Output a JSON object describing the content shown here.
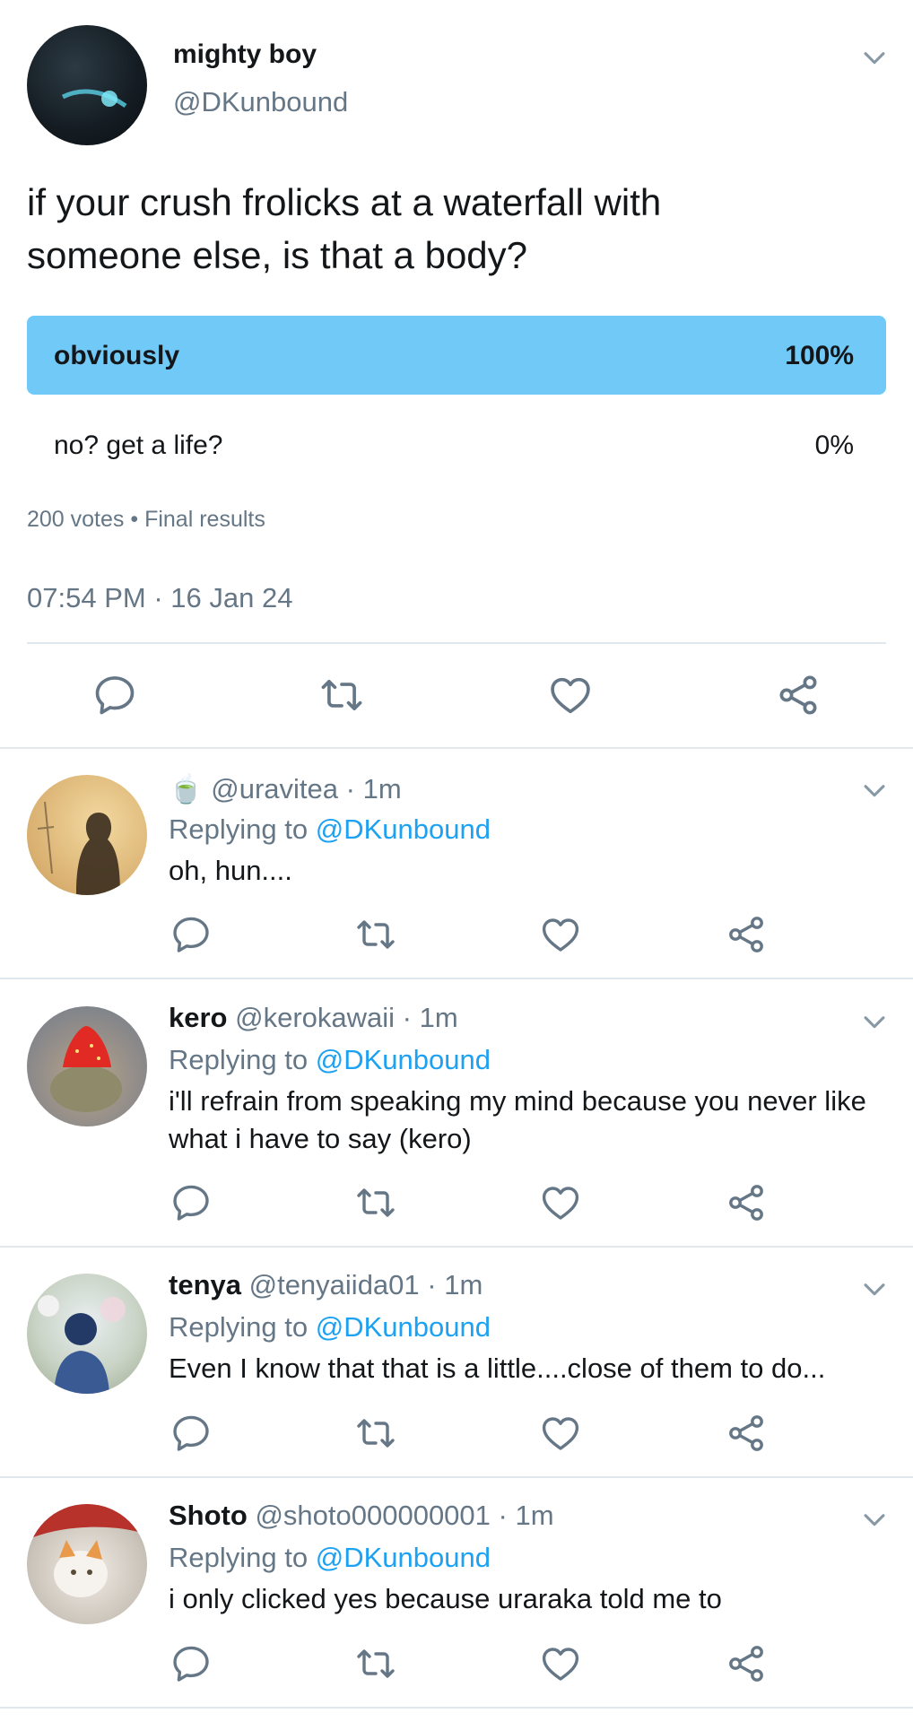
{
  "tweet": {
    "display_name": "mighty boy",
    "handle": "@DKunbound",
    "text": "if your crush frolicks at a waterfall with someone else, is that a body?",
    "poll": {
      "options": [
        {
          "label": "obviously",
          "percent": "100%",
          "value": 1.0
        },
        {
          "label": "no? get a life?",
          "percent": "0%",
          "value": 0.0
        }
      ],
      "votes": "200 votes",
      "status": "Final results"
    },
    "time": "07:54 PM",
    "date": "16 Jan 24"
  },
  "colors": {
    "poll_winner": "#71c9f8",
    "accent": "#1da1f2",
    "secondary_text": "#657786",
    "divider": "#e1e8ed"
  },
  "icons": [
    "chevron-down-icon",
    "reply-icon",
    "retweet-icon",
    "like-icon",
    "share-icon"
  ],
  "replies": [
    {
      "emoji": "🍵",
      "name": "",
      "handle": "@uravitea",
      "time": "1m",
      "replying_prefix": "Replying to",
      "replying_to": "@DKunbound",
      "text": "oh, hun...."
    },
    {
      "name": "kero",
      "handle": "@kerokawaii",
      "time": "1m",
      "replying_prefix": "Replying to",
      "replying_to": "@DKunbound",
      "text": "i'll refrain from speaking my mind because you never like what i have to say (kero)"
    },
    {
      "name": "tenya",
      "handle": "@tenyaiida01",
      "time": "1m",
      "replying_prefix": "Replying to",
      "replying_to": "@DKunbound",
      "text": "Even I know that that is a little....close of them to do..."
    },
    {
      "name": "Shoto",
      "handle": "@shoto000000001",
      "time": "1m",
      "replying_prefix": "Replying to",
      "replying_to": "@DKunbound",
      "text": "i only clicked yes because uraraka told me to"
    }
  ]
}
